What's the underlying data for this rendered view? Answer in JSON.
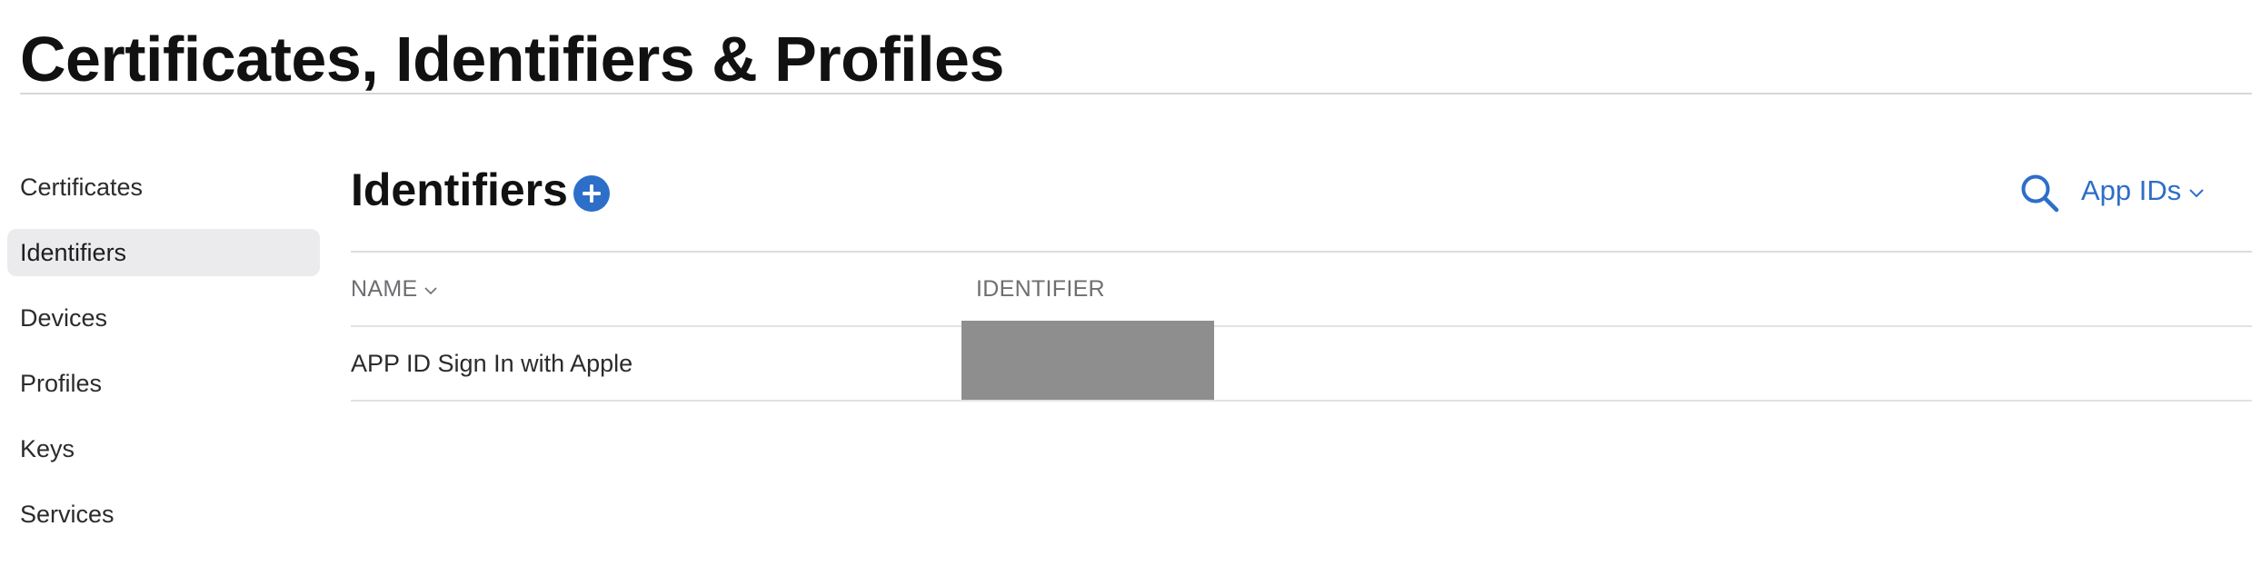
{
  "page": {
    "title": "Certificates, Identifiers & Profiles"
  },
  "sidebar": {
    "items": [
      {
        "label": "Certificates",
        "active": false
      },
      {
        "label": "Identifiers",
        "active": true
      },
      {
        "label": "Devices",
        "active": false
      },
      {
        "label": "Profiles",
        "active": false
      },
      {
        "label": "Keys",
        "active": false
      },
      {
        "label": "Services",
        "active": false
      }
    ]
  },
  "main": {
    "section_title": "Identifiers",
    "add_icon": "plus-circle-icon",
    "search_icon": "search-icon",
    "filter": {
      "selected": "App IDs",
      "icon": "chevron-down-icon"
    },
    "table": {
      "columns": [
        {
          "label": "NAME",
          "sortable": true
        },
        {
          "label": "IDENTIFIER",
          "sortable": false
        }
      ],
      "rows": [
        {
          "name": "APP ID Sign In with Apple",
          "identifier_redacted": true
        }
      ]
    }
  },
  "colors": {
    "accent": "#2d6ec9",
    "active_sidebar_bg": "#ebebed",
    "redaction": "#8e8e8e",
    "rule": "#dcdcde",
    "header_text": "#6e6e73"
  }
}
